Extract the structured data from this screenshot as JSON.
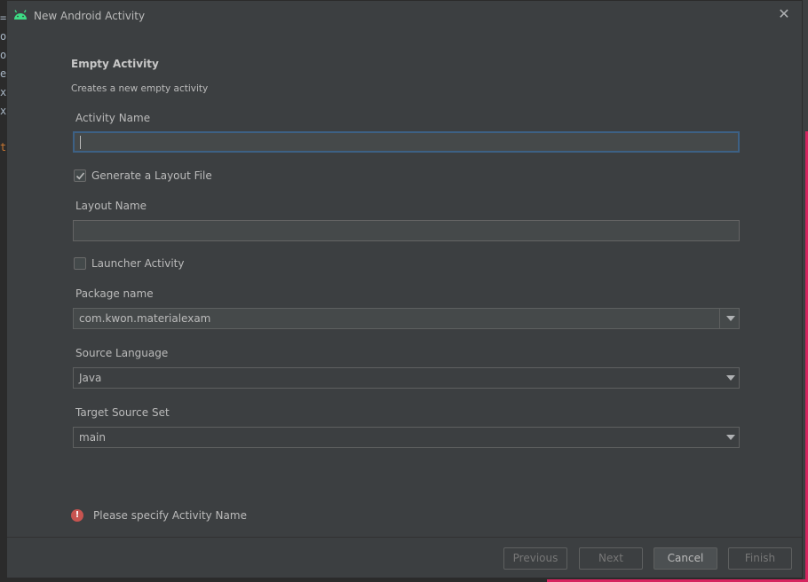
{
  "dialog": {
    "title": "New Android Activity",
    "heading": "Empty Activity",
    "subheading": "Creates a new empty activity"
  },
  "form": {
    "activity_name": {
      "label": "Activity Name",
      "value": ""
    },
    "generate_layout": {
      "label": "Generate a Layout File",
      "checked": true
    },
    "layout_name": {
      "label": "Layout Name",
      "value": ""
    },
    "launcher_activity": {
      "label": "Launcher Activity",
      "checked": false
    },
    "package_name": {
      "label": "Package name",
      "value": "com.kwon.materialexam"
    },
    "source_language": {
      "label": "Source Language",
      "value": "Java"
    },
    "target_source_set": {
      "label": "Target Source Set",
      "value": "main"
    }
  },
  "validation": {
    "message": "Please specify Activity Name",
    "icon": "error-icon"
  },
  "buttons": {
    "previous": "Previous",
    "next": "Next",
    "cancel": "Cancel",
    "finish": "Finish"
  },
  "background_gutter": [
    "=",
    "o",
    "o",
    "e",
    "x",
    "x",
    "",
    "t"
  ],
  "colors": {
    "android_green": "#3ddc84",
    "focus_border": "#3d6185",
    "error_red": "#c75450",
    "accent_pink": "#d6245f"
  }
}
